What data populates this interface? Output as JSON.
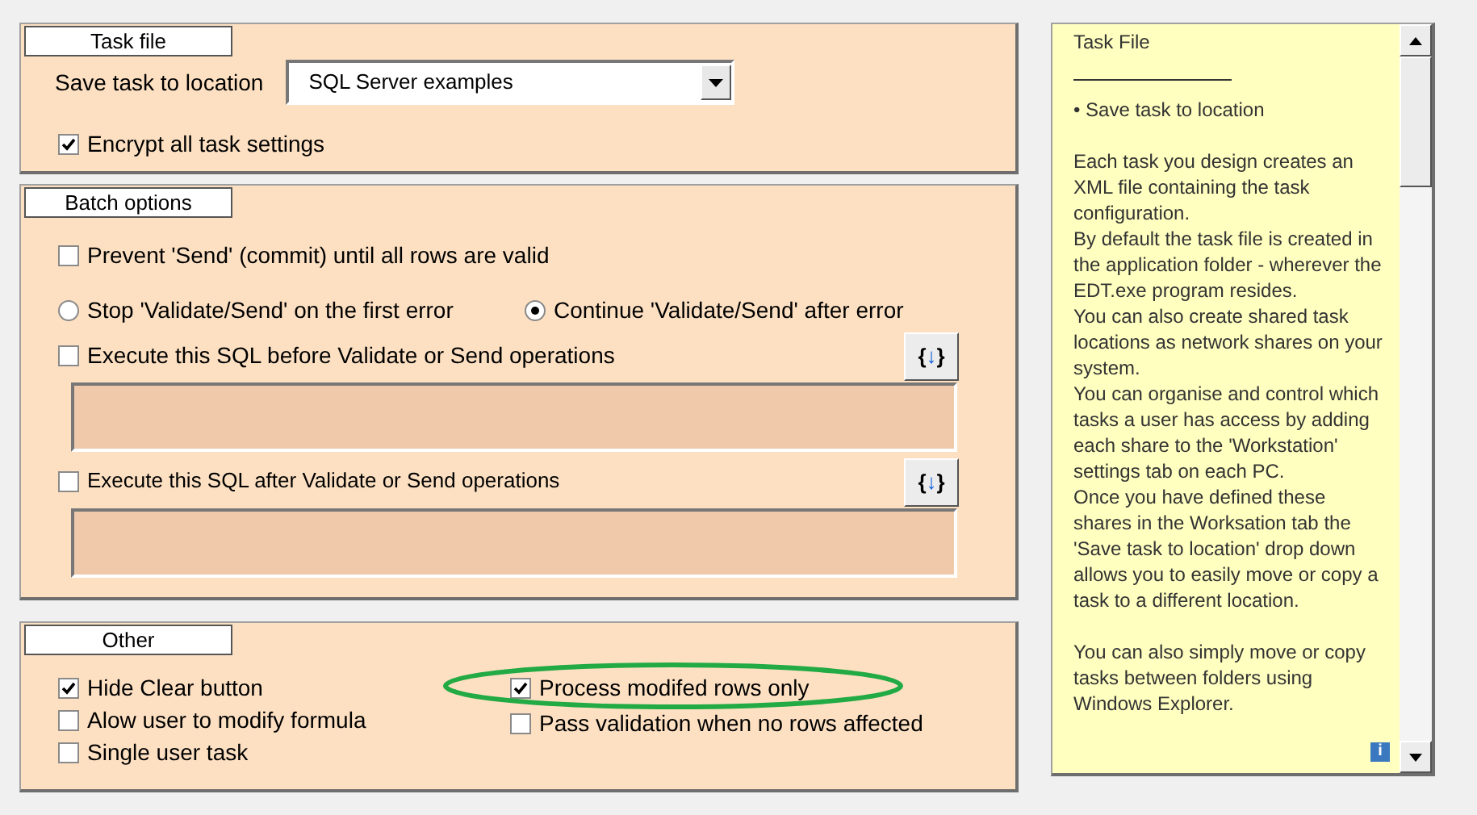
{
  "task_file": {
    "title": "Task file",
    "location_label": "Save task to location",
    "location_value": "SQL Server examples",
    "encrypt": {
      "label": "Encrypt all task settings",
      "checked": true
    }
  },
  "batch_options": {
    "title": "Batch options",
    "prevent_send": {
      "label": "Prevent 'Send' (commit) until all rows are valid",
      "checked": false
    },
    "error_mode": [
      {
        "label": "Stop 'Validate/Send' on the first error",
        "selected": false
      },
      {
        "label": "Continue 'Validate/Send' after error",
        "selected": true
      }
    ],
    "sql_blocks": [
      {
        "label": "Execute this SQL before Validate or Send operations",
        "checked": false,
        "button": "{↓}"
      },
      {
        "label": "Execute this SQL after Validate or Send operations",
        "checked": false,
        "button": "{↓}"
      }
    ]
  },
  "other": {
    "title": "Other",
    "left": [
      {
        "label": "Hide Clear button",
        "checked": true
      },
      {
        "label": "Alow user to modify formula",
        "checked": false
      },
      {
        "label": "Single user task",
        "checked": false
      }
    ],
    "right": [
      {
        "label": "Process modifed rows only",
        "checked": true
      },
      {
        "label": "Pass validation when no rows affected",
        "checked": false
      }
    ]
  },
  "help": {
    "title": "Task File",
    "bullet": "• Save task to location",
    "paragraphs": [
      "Each task you design creates an XML file containing the task configuration.",
      "By default the task file is created in the application folder - wherever the EDT.exe program resides.",
      "You can also create shared task locations as network shares on your system.",
      "You can organise and control which tasks a user has access by adding each share to the 'Workstation' settings tab on each PC.",
      "Once you have defined these shares in the Worksation tab the 'Save task to location' drop down allows you to easily move or copy a task to a different location."
    ],
    "closing": "You can also simply move or copy tasks between folders using Windows Explorer.",
    "info_icon": "i"
  }
}
